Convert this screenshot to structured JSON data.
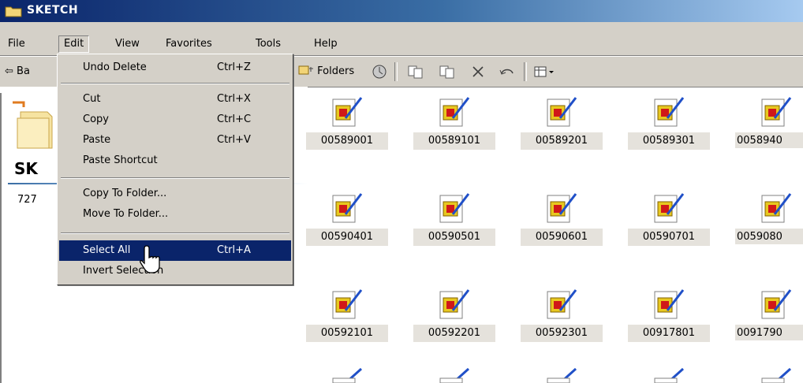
{
  "window": {
    "title": "SKETCH"
  },
  "menubar": {
    "items": [
      "File",
      "Edit",
      "View",
      "Favorites",
      "Tools",
      "Help"
    ]
  },
  "toolbar": {
    "back_label": "Ba",
    "folders_label": "Folders"
  },
  "folder_panel": {
    "name": "SK",
    "count_partial": "727"
  },
  "edit_menu": {
    "undo": {
      "label": "Undo Delete",
      "shortcut": "Ctrl+Z"
    },
    "cut": {
      "label": "Cut",
      "shortcut": "Ctrl+X"
    },
    "copy": {
      "label": "Copy",
      "shortcut": "Ctrl+C"
    },
    "paste": {
      "label": "Paste",
      "shortcut": "Ctrl+V"
    },
    "paste_shortcut": {
      "label": "Paste Shortcut"
    },
    "copy_to_folder": {
      "label": "Copy To Folder..."
    },
    "move_to_folder": {
      "label": "Move To Folder..."
    },
    "select_all": {
      "label": "Select All",
      "shortcut": "Ctrl+A"
    },
    "invert_selection": {
      "label": "Invert Selection"
    }
  },
  "files": {
    "row1": [
      "00589001",
      "00589101",
      "00589201",
      "00589301",
      "0058940"
    ],
    "row2": [
      "00590401",
      "00590501",
      "00590601",
      "00590701",
      "0059080"
    ],
    "row3": [
      "00592101",
      "00592201",
      "00592301",
      "00917801",
      "0091790"
    ]
  },
  "colors": {
    "title_bar": "#0a246a",
    "menu_bg": "#d4d0c8",
    "selection": "#0a246a"
  }
}
